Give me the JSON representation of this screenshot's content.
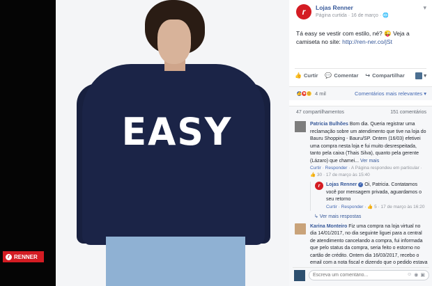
{
  "photo": {
    "shirt_text": "EASY",
    "brand_tag": "RENNER",
    "brand_mark": "r"
  },
  "post": {
    "page_logo": "r",
    "page_name": "Lojas Renner",
    "meta": "Página curtida · 16 de março · ",
    "more": "▾",
    "text": "Tá easy se vestir com estilo, né? 😜 Veja a camiseta no site: ",
    "link": "http://ren-ner.co/jSt"
  },
  "actions": {
    "like": "Curtir",
    "comment": "Comentar",
    "share": "Compartilhar"
  },
  "reactions": {
    "count": "4 mil",
    "sort": "Comentários mais relevantes ▾"
  },
  "counts": {
    "shares": "47 compartilhamentos",
    "comments": "151 comentários"
  },
  "comments": [
    {
      "name": "Patricia Bulhões",
      "text": "Bom dia. Queria registrar uma reclamação sobre um atendimento que tive na loja do Bauru Shopping - Bauru/SP. Ontem (16/03) efetivei uma compra nesta loja e fui muito desrespeitada, tanto pela caixa (Thais Silva), quanto pela gerente (Lázaro) que chamei...",
      "see_more": "Ver mais",
      "actions": "Curtir · Responder · ",
      "meta": "A Página respondeu em particular · ",
      "likes": "30",
      "time": " · 17 de março às 15:40",
      "reply": {
        "name": "Lojas Renner",
        "text": "Oi, Patricia. Contatamos você por mensagem privada, aguardamos o seu retorno",
        "actions": "Curtir · Responder · ",
        "likes": "5",
        "time": " · 17 de março às 16:20"
      },
      "more_replies": "↳ Ver mais respostas"
    },
    {
      "name": "Karina Monteiro",
      "text": "Fiz uma compra na loja virtual no dia 14/01/2017, no dia seguinte liguei para a central de atendimento cancelando a compra, fui informada que pelo status da compra, seria feito o estorno no cartão de crédito. Ontem dia 16/03/2017, recebo o email com a nota fiscal e dizendo que o pedido estava sendo enviado."
    }
  ],
  "composer": {
    "placeholder": "Escreva um comentário..."
  }
}
